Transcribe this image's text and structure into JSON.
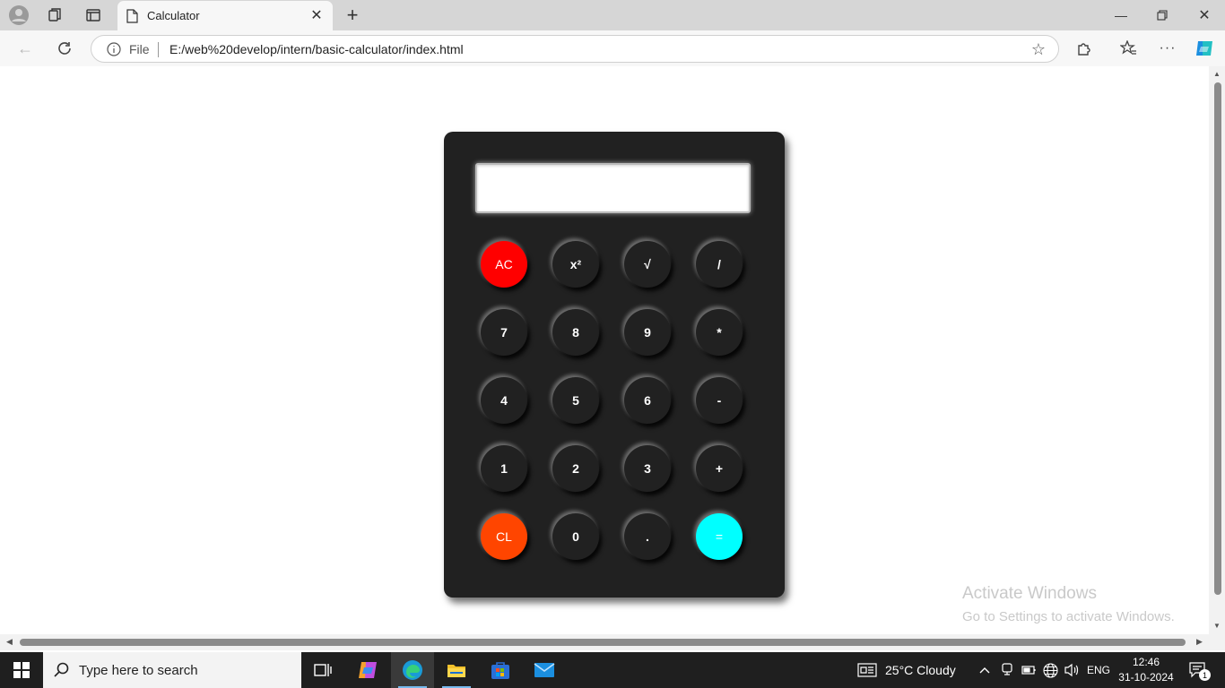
{
  "browser": {
    "tab_title": "Calculator",
    "address": {
      "scheme_label": "File",
      "url": "E:/web%20develop/intern/basic-calculator/index.html"
    }
  },
  "calculator": {
    "display_value": "",
    "keys": [
      {
        "label": "AC",
        "kind": "clear-all",
        "color": "#ff0000"
      },
      {
        "label": "x²",
        "kind": "square"
      },
      {
        "label": "√",
        "kind": "sqrt"
      },
      {
        "label": "/",
        "kind": "divide"
      },
      {
        "label": "7",
        "kind": "digit"
      },
      {
        "label": "8",
        "kind": "digit"
      },
      {
        "label": "9",
        "kind": "digit"
      },
      {
        "label": "*",
        "kind": "multiply"
      },
      {
        "label": "4",
        "kind": "digit"
      },
      {
        "label": "5",
        "kind": "digit"
      },
      {
        "label": "6",
        "kind": "digit"
      },
      {
        "label": "-",
        "kind": "subtract"
      },
      {
        "label": "1",
        "kind": "digit"
      },
      {
        "label": "2",
        "kind": "digit"
      },
      {
        "label": "3",
        "kind": "digit"
      },
      {
        "label": "+",
        "kind": "add"
      },
      {
        "label": "CL",
        "kind": "clear-last",
        "color": "#ff4500"
      },
      {
        "label": "0",
        "kind": "digit"
      },
      {
        "label": ".",
        "kind": "decimal"
      },
      {
        "label": "=",
        "kind": "equals",
        "color": "#00ffff"
      }
    ]
  },
  "watermark": {
    "line1": "Activate Windows",
    "line2": "Go to Settings to activate Windows."
  },
  "taskbar": {
    "search_placeholder": "Type here to search",
    "weather": "25°C  Cloudy",
    "language": "ENG",
    "time": "12:46",
    "date": "31-10-2024",
    "notification_count": "1"
  }
}
